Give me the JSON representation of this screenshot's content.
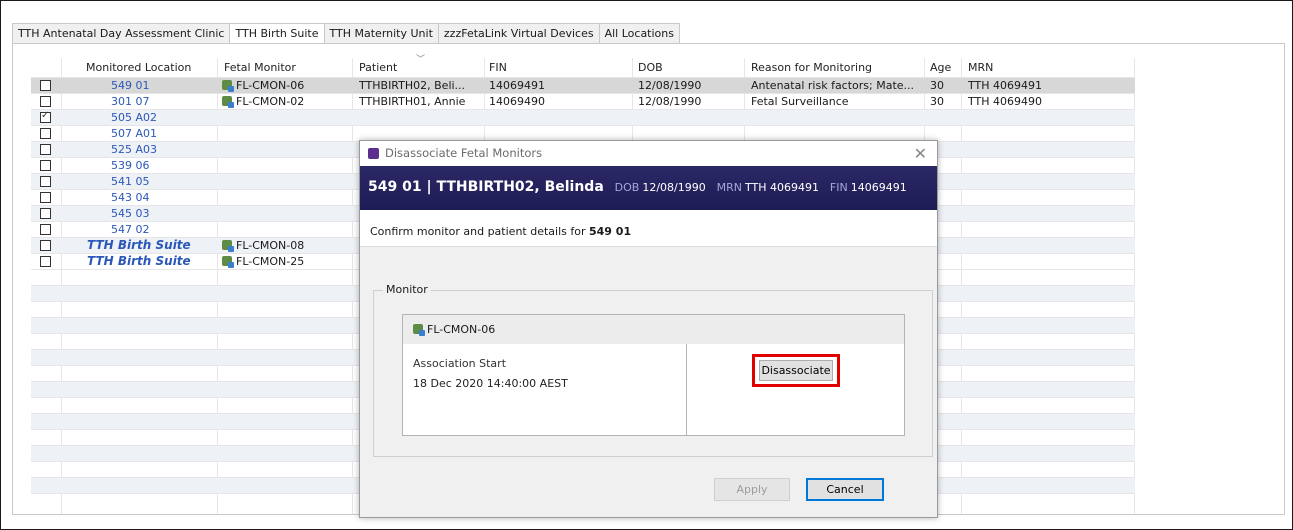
{
  "tabs": [
    {
      "label": "TTH Antenatal Day Assessment Clinic",
      "active": false
    },
    {
      "label": "TTH Birth Suite",
      "active": true
    },
    {
      "label": "TTH Maternity Unit",
      "active": false
    },
    {
      "label": "zzzFetaLink Virtual Devices",
      "active": false
    },
    {
      "label": "All Locations",
      "active": false
    }
  ],
  "table": {
    "headers": {
      "location": "Monitored Location",
      "monitor": "Fetal Monitor",
      "patient": "Patient",
      "fin": "FIN",
      "dob": "DOB",
      "reason": "Reason for Monitoring",
      "age": "Age",
      "mrn": "MRN"
    },
    "rows": [
      {
        "location": "549 01",
        "monitor": "FL-CMON-06",
        "patient": "TTHBIRTH02, Beli...",
        "fin": "14069491",
        "dob": "12/08/1990",
        "reason": "Antenatal risk factors; Mate...",
        "age": "30",
        "mrn": "TTH 4069491",
        "checked": false
      },
      {
        "location": "301 07",
        "monitor": "FL-CMON-02",
        "patient": "TTHBIRTH01, Annie",
        "fin": "14069490",
        "dob": "12/08/1990",
        "reason": "Fetal Surveillance",
        "age": "30",
        "mrn": "TTH 4069490",
        "checked": false
      },
      {
        "location": "505 A02",
        "monitor": "",
        "patient": "",
        "fin": "",
        "dob": "",
        "reason": "",
        "age": "",
        "mrn": "",
        "checked": true
      },
      {
        "location": "507 A01",
        "monitor": "",
        "patient": "",
        "fin": "",
        "dob": "",
        "reason": "",
        "age": "",
        "mrn": "",
        "checked": false
      },
      {
        "location": "525 A03",
        "monitor": "",
        "patient": "",
        "fin": "",
        "dob": "",
        "reason": "",
        "age": "",
        "mrn": "",
        "checked": false
      },
      {
        "location": "539 06",
        "monitor": "",
        "patient": "",
        "fin": "",
        "dob": "",
        "reason": "",
        "age": "",
        "mrn": "",
        "checked": false
      },
      {
        "location": "541 05",
        "monitor": "",
        "patient": "",
        "fin": "",
        "dob": "",
        "reason": "",
        "age": "",
        "mrn": "",
        "checked": false
      },
      {
        "location": "543 04",
        "monitor": "",
        "patient": "",
        "fin": "",
        "dob": "",
        "reason": "",
        "age": "",
        "mrn": "",
        "checked": false
      },
      {
        "location": "545 03",
        "monitor": "",
        "patient": "",
        "fin": "",
        "dob": "",
        "reason": "",
        "age": "",
        "mrn": "",
        "checked": false
      },
      {
        "location": "547 02",
        "monitor": "",
        "patient": "",
        "fin": "",
        "dob": "",
        "reason": "",
        "age": "",
        "mrn": "",
        "checked": false
      },
      {
        "location": "TTH Birth Suite",
        "monitor": "FL-CMON-08",
        "patient": "",
        "fin": "",
        "dob": "",
        "reason": "",
        "age": "",
        "mrn": "",
        "checked": false
      },
      {
        "location": "TTH Birth Suite",
        "monitor": "FL-CMON-25",
        "patient": "",
        "fin": "",
        "dob": "",
        "reason": "",
        "age": "",
        "mrn": "",
        "checked": false
      }
    ]
  },
  "dialog": {
    "title": "Disassociate Fetal Monitors",
    "banner": {
      "location": "549 01",
      "separator": "|",
      "patient": "TTHBIRTH02, Belinda",
      "dob_label": "DOB",
      "dob": "12/08/1990",
      "mrn_label": "MRN",
      "mrn": "TTH 4069491",
      "fin_label": "FIN",
      "fin": "14069491"
    },
    "confirm_text": "Confirm monitor and patient details for",
    "confirm_location": "549 01",
    "group_label": "Monitor",
    "monitor_name": "FL-CMON-06",
    "association_start_label": "Association Start",
    "association_start_value": "18 Dec 2020 14:40:00 AEST",
    "disassociate_label": "Disassociate",
    "apply_label": "Apply",
    "cancel_label": "Cancel"
  },
  "colors": {
    "banner": "#23215e",
    "location_link": "#2b58b8",
    "highlight": "#e00000",
    "selected_row": "#d7d7d7"
  }
}
